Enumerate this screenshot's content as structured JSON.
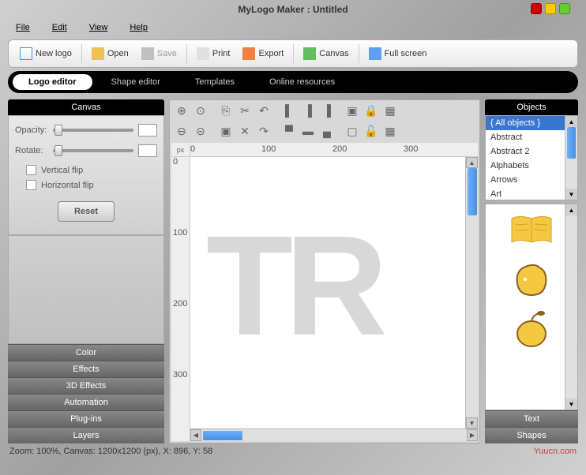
{
  "title": "MyLogo Maker : Untitled",
  "menu": {
    "file": "File",
    "edit": "Edit",
    "view": "View",
    "help": "Help"
  },
  "toolbar": {
    "new": "New logo",
    "open": "Open",
    "save": "Save",
    "print": "Print",
    "export": "Export",
    "canvas": "Canvas",
    "fullscreen": "Full screen"
  },
  "nav": {
    "logo_editor": "Logo editor",
    "shape_editor": "Shape editor",
    "templates": "Templates",
    "online": "Online resources"
  },
  "left": {
    "header": "Canvas",
    "opacity": "Opacity:",
    "rotate": "Rotate:",
    "vflip": "Vertical flip",
    "hflip": "Horizontal flip",
    "reset": "Reset",
    "tabs": [
      "Color",
      "Effects",
      "3D Effects",
      "Automation",
      "Plug-ins",
      "Layers"
    ]
  },
  "ruler": {
    "corner": "px",
    "h": [
      "0",
      "100",
      "200",
      "300"
    ],
    "v": [
      "0",
      "100",
      "200",
      "300"
    ]
  },
  "right": {
    "header": "Objects",
    "items": [
      "{ All objects }",
      "Abstract",
      "Abstract 2",
      "Alphabets",
      "Arrows",
      "Art"
    ],
    "tabs": [
      "Text",
      "Shapes"
    ]
  },
  "status": "Zoom: 100%, Canvas: 1200x1200 (px), X: 896, Y: 58",
  "watermark_site": "Yuucn.com"
}
